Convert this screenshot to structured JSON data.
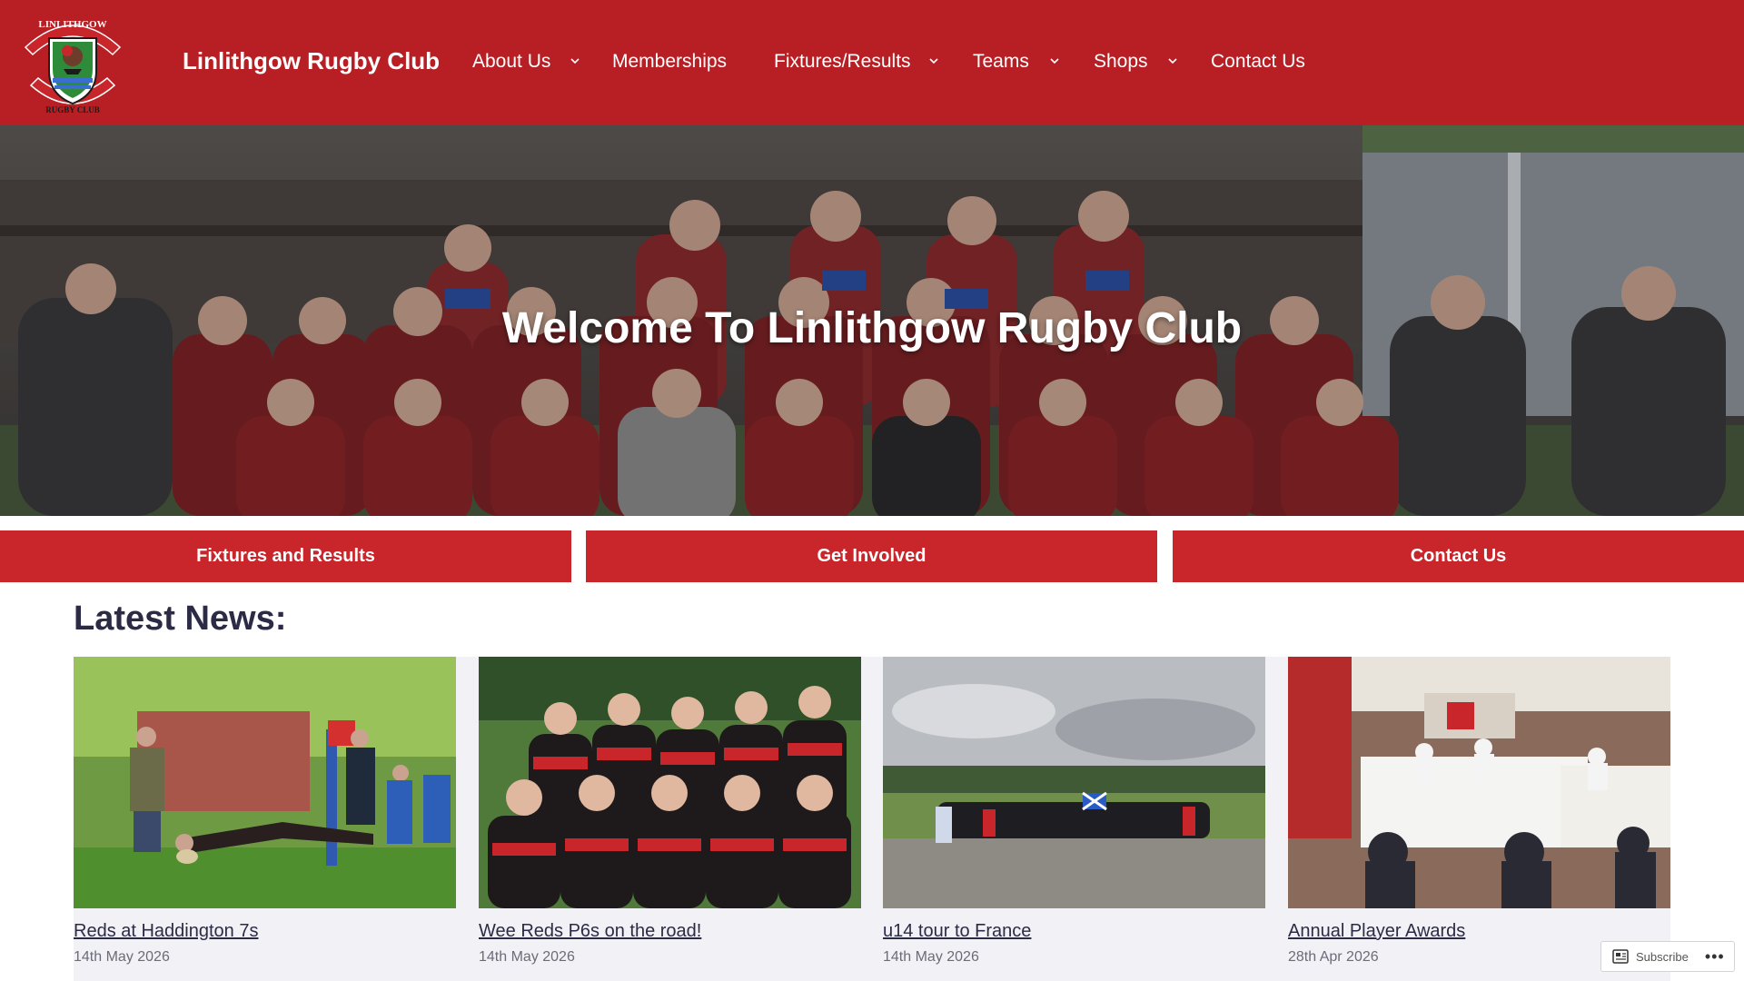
{
  "header": {
    "logo_top_text": "LINLITHGOW",
    "logo_bottom_text": "RUGBY CLUB",
    "site_title": "Linlithgow Rugby Club",
    "nav": [
      {
        "label": "About Us",
        "has_dropdown": true
      },
      {
        "label": "Memberships",
        "has_dropdown": false
      },
      {
        "label": "Fixtures/Results",
        "has_dropdown": true
      },
      {
        "label": "Teams",
        "has_dropdown": true
      },
      {
        "label": "Shops",
        "has_dropdown": true
      },
      {
        "label": "Contact Us",
        "has_dropdown": false
      }
    ],
    "chevron_icon": "chevron-down-icon"
  },
  "hero": {
    "title": "Welcome To Linlithgow Rugby Club"
  },
  "cta": [
    {
      "label": "Fixtures and Results"
    },
    {
      "label": "Get Involved"
    },
    {
      "label": "Contact Us"
    }
  ],
  "news": {
    "heading": "Latest News:",
    "posts": [
      {
        "title": "Reds at Haddington 7s",
        "date": "14th May 2026"
      },
      {
        "title": "Wee Reds P6s on the road!",
        "date": "14th May 2026"
      },
      {
        "title": "u14 tour to France",
        "date": "14th May 2026"
      },
      {
        "title": "Annual Player Awards",
        "date": "28th Apr 2026"
      }
    ]
  },
  "subscribe": {
    "label": "Subscribe",
    "more": "•••",
    "icon": "reader-icon"
  },
  "colors": {
    "header_red": "#b81f24",
    "button_red": "#c8262b",
    "heading_navy": "#2b2b45"
  }
}
